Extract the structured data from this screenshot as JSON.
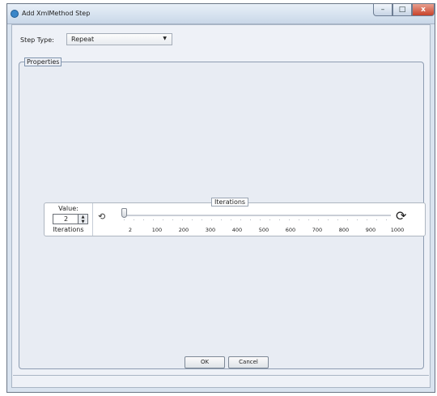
{
  "window": {
    "title": "Add XmlMethod Step",
    "controls": {
      "minimize": "–",
      "maximize": "□",
      "close": "x"
    }
  },
  "step_type": {
    "label": "Step Type:",
    "selected": "Repeat"
  },
  "properties": {
    "title": "Properties",
    "value_label": "Value:",
    "spinner_value": "2",
    "unit_label": "Iterations",
    "slider": {
      "title": "Iterations",
      "value": 2,
      "min": 2,
      "max": 1000,
      "ticks": [
        "2",
        "100",
        "200",
        "300",
        "400",
        "500",
        "600",
        "700",
        "800",
        "900",
        "1000"
      ],
      "reset_icon": "reset-icon",
      "sync_icon": "sync-icon"
    }
  },
  "buttons": {
    "ok": "OK",
    "cancel": "Cancel"
  },
  "colors": {
    "frame": "#d9e3ef",
    "panel": "#eef1f7",
    "close": "#c7422a"
  }
}
